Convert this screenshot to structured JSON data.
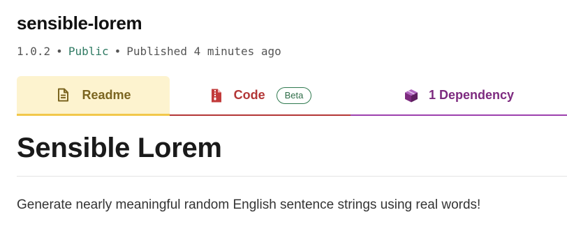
{
  "package": {
    "name": "sensible-lorem",
    "version": "1.0.2",
    "separator": "•",
    "visibility": "Public",
    "published": "Published 4 minutes ago"
  },
  "tabs": [
    {
      "label": "Readme",
      "icon": "readme-file-icon",
      "selected": true
    },
    {
      "label": "Code",
      "icon": "code-file-icon",
      "badge": "Beta",
      "selected": false
    },
    {
      "label": "1 Dependency",
      "icon": "package-box-icon",
      "selected": false
    }
  ],
  "readme": {
    "title": "Sensible Lorem",
    "description": "Generate nearly meaningful random English sentence strings using real words!"
  },
  "colors": {
    "readme_accent": "#f2c84b",
    "code_accent": "#b33636",
    "dependency_accent": "#9d3fae",
    "public_text": "#2f7a63",
    "beta_badge": "#2f7a4f"
  }
}
